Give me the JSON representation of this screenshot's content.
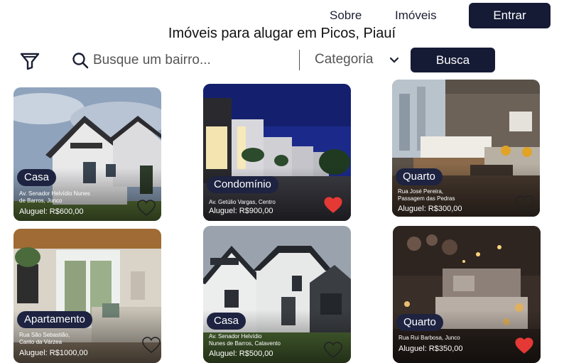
{
  "nav": {
    "sobre": "Sobre",
    "imoveis": "Imóveis",
    "entrar": "Entrar"
  },
  "page": {
    "title": "Imóveis para alugar em Picos, Piauí"
  },
  "search": {
    "placeholder": "Busque um bairro...",
    "category_label": "Categoria",
    "button": "Busca"
  },
  "icons": [
    "filter-icon",
    "search-icon",
    "chevron-down-icon",
    "heart-icon"
  ],
  "colors": {
    "primary": "#151a35",
    "pill": "#1d2340",
    "favorite": "#e53935"
  },
  "listings": [
    {
      "category": "Casa",
      "address_line1": "Av. Senador Helvídio Nunes",
      "address_line2": "de Barros, Junco",
      "price": "Aluguel: R$600,00",
      "favorite": false
    },
    {
      "category": "Condomínio",
      "address_line1": "Av. Getúlio Vargas, Centro",
      "address_line2": "",
      "price": "Aluguel: R$900,00",
      "favorite": true
    },
    {
      "category": "Quarto",
      "address_line1": "Rua José Pereira,",
      "address_line2": "Passagem das Pedras",
      "price": "Aluguel: R$300,00",
      "favorite": false
    },
    {
      "category": "Apartamento",
      "address_line1": "Rua São Sebastião,",
      "address_line2": "Canto da Várzea",
      "price": "Aluguel: R$1000,00",
      "favorite": false
    },
    {
      "category": "Casa",
      "address_line1": "Av. Senador Helvídio",
      "address_line2": "Nunes de Barros, Catavento",
      "price": "Aluguel: R$500,00",
      "favorite": false
    },
    {
      "category": "Quarto",
      "address_line1": "Rua Rui Barbosa, Junco",
      "address_line2": "",
      "price": "Aluguel: R$350,00",
      "favorite": true
    }
  ]
}
